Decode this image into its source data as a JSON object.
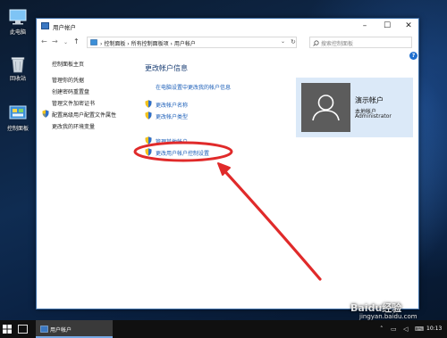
{
  "desktop": {
    "icons": [
      {
        "label": "此电脑",
        "icon": "computer-icon"
      },
      {
        "label": "回收站",
        "icon": "recycle-bin-icon"
      },
      {
        "label": "控制面板",
        "icon": "control-panel-icon"
      }
    ]
  },
  "window": {
    "title": "用户帐户",
    "address": {
      "crumbs": [
        "控制面板",
        "所有控制面板项",
        "用户帐户"
      ],
      "search_placeholder": "搜索控制面板"
    },
    "left_nav": {
      "home": "控制面板主页",
      "items": [
        "管理你的凭据",
        "创建密码重置盘",
        "管理文件加密证书",
        "配置高级用户配置文件属性",
        "更改我的环境变量"
      ]
    },
    "main": {
      "heading": "更改帐户信息",
      "settings_link": "在电脑设置中更改我的帐户信息",
      "links_group1": [
        "更改帐户名称",
        "更改帐户类型"
      ],
      "links_group2": [
        "管理其他帐户",
        "更改用户帐户控制设置"
      ]
    },
    "user_card": {
      "name": "演示帐户",
      "type": "本地帐户",
      "role": "Administrator"
    }
  },
  "taskbar": {
    "app_label": "用户帐户",
    "clock": "10:13"
  },
  "watermark": {
    "brand": "Baidu经验",
    "url": "jingyan.baidu.com"
  },
  "colors": {
    "accent": "#1b5eb8",
    "annotation": "#e02a2a",
    "user_card_bg": "#dbe9f8"
  }
}
